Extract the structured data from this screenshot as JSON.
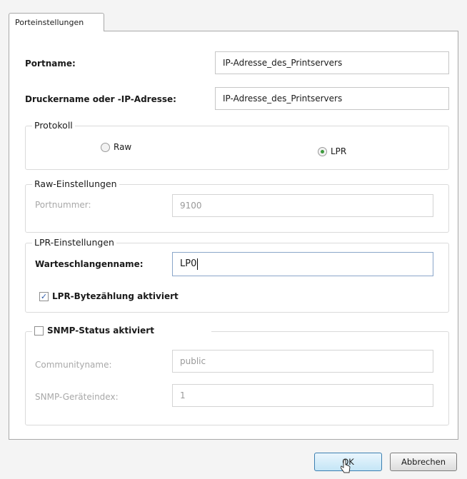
{
  "tab": {
    "label": "Porteinstellungen"
  },
  "port": {
    "portname_label": "Portname:",
    "portname_value": "IP-Adresse_des_Printservers",
    "printer_label": "Druckername oder -IP-Adresse:",
    "printer_value": "IP-Adresse_des_Printservers"
  },
  "protocol": {
    "legend": "Protokoll",
    "raw_label": "Raw",
    "lpr_label": "LPR",
    "selected": "LPR"
  },
  "raw_settings": {
    "legend": "Raw-Einstellungen",
    "port_number_label": "Portnummer:",
    "port_number_value": "9100"
  },
  "lpr_settings": {
    "legend": "LPR-Einstellungen",
    "queue_label": "Warteschlangenname:",
    "queue_value": "LP0",
    "byte_count_label": "LPR-Bytezählung aktiviert",
    "byte_count_checked": true
  },
  "snmp": {
    "status_label": "SNMP-Status aktiviert",
    "status_checked": false,
    "community_label": "Communityname:",
    "community_value": "public",
    "device_index_label": "SNMP-Geräteindex:",
    "device_index_value": "1"
  },
  "buttons": {
    "ok": "OK",
    "cancel": "Abbrechen"
  },
  "colors": {
    "radio_selected": "#3d9a3d",
    "checkmark": "#2e5aa8",
    "default_button_border": "#3c7fb1"
  }
}
